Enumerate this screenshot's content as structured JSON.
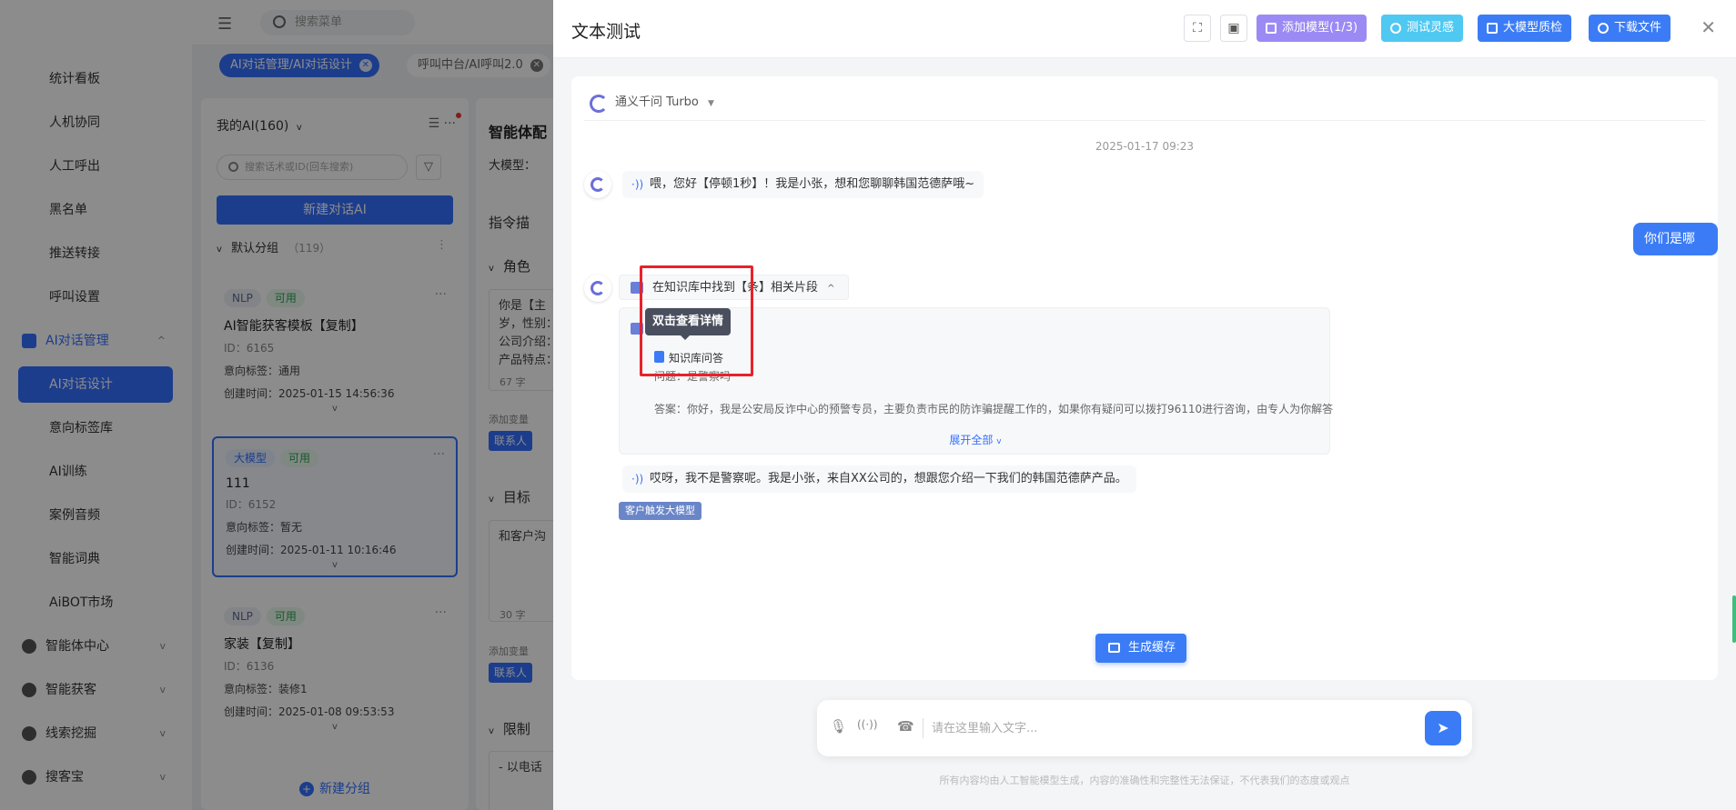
{
  "sidebar": {
    "items": [
      {
        "label": "统计看板"
      },
      {
        "label": "人机协同"
      },
      {
        "label": "人工呼出"
      },
      {
        "label": "黑名单"
      },
      {
        "label": "推送转接"
      },
      {
        "label": "呼叫设置"
      }
    ],
    "ai_group": {
      "label": "AI对话管理",
      "chevron": "^"
    },
    "ai_items": [
      {
        "label": "AI对话设计",
        "active": true
      },
      {
        "label": "意向标签库"
      },
      {
        "label": "AI训练"
      },
      {
        "label": "案例音频"
      },
      {
        "label": "智能词典"
      },
      {
        "label": "AiBOT市场"
      }
    ],
    "groups": [
      {
        "label": "智能体中心",
        "chevron": "v"
      },
      {
        "label": "智能获客",
        "chevron": "v"
      },
      {
        "label": "线索挖掘",
        "chevron": "v"
      },
      {
        "label": "搜客宝",
        "chevron": "v"
      }
    ]
  },
  "topbar": {
    "menu_icon": "hamburger-icon",
    "search_placeholder": "搜索菜单"
  },
  "tabs": [
    {
      "label": "AI对话管理/AI对话设计",
      "active": true
    },
    {
      "label": "呼叫中台/AI呼叫2.0",
      "active": false
    }
  ],
  "ai_list": {
    "title": "我的AI(160)",
    "title_caret": "v",
    "tools": "☰ ···",
    "search_placeholder": "搜索话术或ID(回车搜索)",
    "filter_icon": "▽",
    "new_button": "新建对话AI",
    "group": {
      "chev": "v",
      "name": "默认分组",
      "count": "（119）",
      "more": "⋮"
    },
    "cards": [
      {
        "badges": [
          "NLP",
          "可用"
        ],
        "more": "···",
        "title": "AI智能获客模板【复制】",
        "id": "ID：6165",
        "tag": "意向标签：通用",
        "time": "创建时间：2025-01-15 14:56:36",
        "chev": "v"
      },
      {
        "badges": [
          "大模型",
          "可用"
        ],
        "more": "···",
        "title": "111",
        "id": "ID：6152",
        "tag": "意向标签：暂无",
        "time": "创建时间：2025-01-11 10:16:46",
        "chev": "v"
      },
      {
        "badges": [
          "NLP",
          "可用"
        ],
        "more": "···",
        "title": "家装【复制】",
        "id": "ID：6136",
        "tag": "意向标签：装修1",
        "time": "创建时间：2025-01-08 09:53:53",
        "chev": "v"
      }
    ],
    "new_group": "新建分组",
    "new_group_plus": "+"
  },
  "config": {
    "title": "智能体配",
    "model_label": "大模型：",
    "section1": "指令描",
    "role_label": "角色",
    "role_text": "你是【主\n岁，性别：\n公司介绍：\n产品特点：",
    "role_count": "67 字",
    "add_var1": "添加变量",
    "tag1": "联系人",
    "goal_label": "目标",
    "goal_text": "和客户沟",
    "goal_count": "30 字",
    "add_var2": "添加变量",
    "tag2": "联系人",
    "limit_label": "限制",
    "limit_text": "- 以电话",
    "caret": "v"
  },
  "drawer": {
    "title": "文本测试",
    "fullscreen_icon": "⛶",
    "box_icon": "▣",
    "buttons": {
      "add_model": "添加模型(1/3)",
      "test_inspiration": "测试灵感",
      "quality_check": "大模型质检",
      "download": "下载文件"
    },
    "close": "✕"
  },
  "chat": {
    "model_name": "通义千问 Turbo",
    "model_caret": "▼",
    "timestamp": "2025-01-17 09:23",
    "voice_icon": "·))",
    "bot_greeting": "喂，您好【停顿1秒】！我是小张，想和您聊聊韩国范德萨哦~",
    "user_message": "你们是哪里",
    "kb_header": "在知识库中找到【条】相关片段",
    "kb_up": "^",
    "kb_doc": "知识库问答",
    "kb_question": "问题：是警察吗",
    "kb_answer": "答案：你好，我是公安局反诈中心的预警专员，主要负责市民的防诈骗提醒工作的，如果你有疑问可以拨打96110进行咨询，由专人为你解答",
    "kb_expand": "展开全部",
    "kb_expand_caret": "v",
    "tooltip": "双击查看详情",
    "bot_reply": "哎呀，我不是警察呢。我是小张，来自XX公司的，想跟您介绍一下我们的韩国范德萨产品。",
    "trigger_tag": "客户触发大模型",
    "gen_cache": "生成缓存"
  },
  "input": {
    "mic_icon": "🎙",
    "signal_icon": "((·))",
    "hangup_icon": "☎",
    "placeholder": "请在这里输入文字...",
    "send_icon": "➤"
  },
  "disclaimer": "所有内容均由人工智能模型生成，内容的准确性和完整性无法保证，不代表我们的态度或观点",
  "colors": {
    "primary": "#3370ff",
    "button_blue": "#3b7cf6",
    "button_purple": "#9b8af4",
    "button_cyan": "#4fc8f2",
    "highlight_red": "#e8212b",
    "tooltip_bg": "#4a4f5e"
  }
}
